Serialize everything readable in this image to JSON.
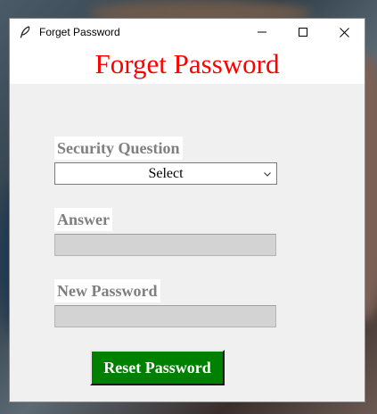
{
  "window": {
    "title": "Forget Password",
    "icon": "feather-icon",
    "controls": {
      "minimize_icon": "minimize-icon",
      "maximize_icon": "maximize-icon",
      "close_icon": "close-icon"
    }
  },
  "header": {
    "title": "Forget Password",
    "color": "#ff0000"
  },
  "form": {
    "security_question": {
      "label": "Security Question",
      "selected": "Select"
    },
    "answer": {
      "label": "Answer",
      "value": ""
    },
    "new_password": {
      "label": "New Password",
      "value": ""
    },
    "reset_button": {
      "label": "Reset Password",
      "color": "#008000"
    }
  }
}
